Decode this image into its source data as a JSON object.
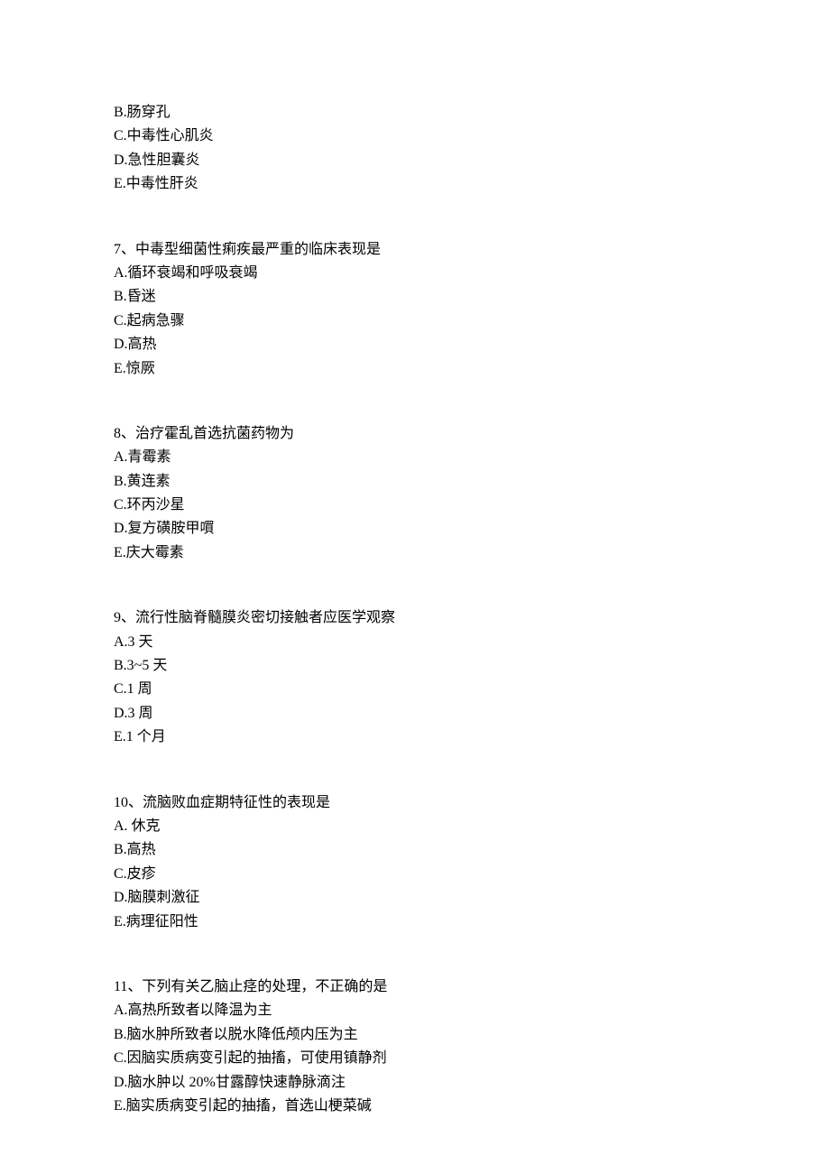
{
  "orphan_options": [
    "B.肠穿孔",
    "C.中毒性心肌炎",
    "D.急性胆囊炎",
    "E.中毒性肝炎"
  ],
  "questions": [
    {
      "number": "7、",
      "stem": "中毒型细菌性痢疾最严重的临床表现是",
      "options": [
        "A.循环衰竭和呼吸衰竭",
        "B.昏迷",
        "C.起病急骤",
        "D.高热",
        "E.惊厥"
      ]
    },
    {
      "number": "8、",
      "stem": "治疗霍乱首选抗菌药物为",
      "options": [
        "A.青霉素",
        "B.黄连素",
        "C.环丙沙星",
        "D.复方磺胺甲嘪",
        "E.庆大霉素"
      ]
    },
    {
      "number": "9、",
      "stem": "流行性脑脊髓膜炎密切接触者应医学观察",
      "options": [
        "A.3 天",
        "B.3~5 天",
        "C.1 周",
        "D.3 周",
        "E.1 个月"
      ]
    },
    {
      "number": "10、",
      "stem": "流脑败血症期特征性的表现是",
      "options": [
        "A. 休克",
        "B.高热",
        "C.皮疹",
        "D.脑膜刺激征",
        "E.病理征阳性"
      ]
    },
    {
      "number": "11、",
      "stem": "下列有关乙脑止痉的处理，不正确的是",
      "options": [
        "A.高热所致者以降温为主",
        "B.脑水肿所致者以脱水降低颅内压为主",
        "C.因脑实质病变引起的抽搐，可使用镇静剂",
        "D.脑水肿以 20%甘露醇快速静脉滴注",
        "E.脑实质病变引起的抽搐，首选山梗菜碱"
      ]
    }
  ]
}
